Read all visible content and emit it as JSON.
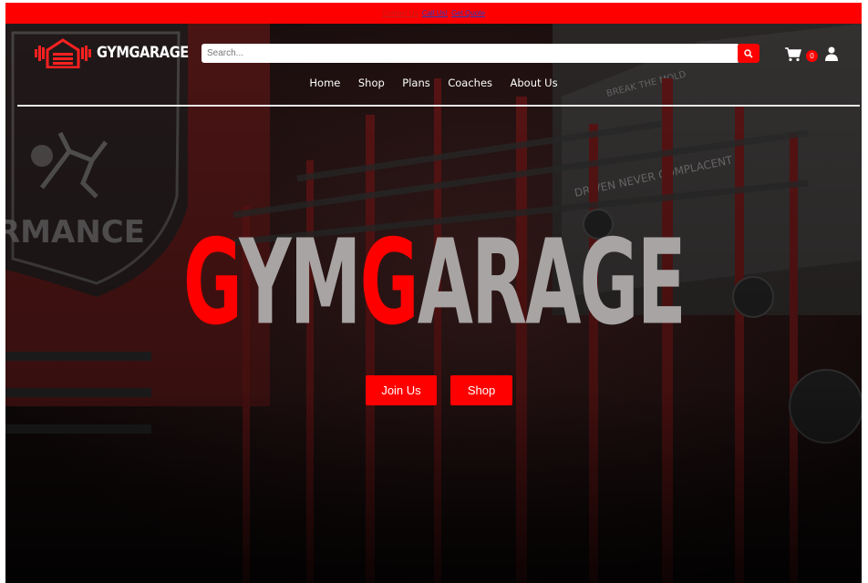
{
  "topbar": {
    "contact_label": "Contact Us",
    "call_label": "Call Us!",
    "quote_label": "Get Quote",
    "background_color": "#ff0000"
  },
  "brand": {
    "name": "GYMGARAGE",
    "logo_icon": "garage-dumbbell-icon",
    "accent_color": "#ff0000"
  },
  "search": {
    "placeholder": "Search...",
    "value": "",
    "button_icon": "search-icon"
  },
  "cart": {
    "icon": "cart-icon",
    "count": "0"
  },
  "account": {
    "icon": "user-icon"
  },
  "nav": {
    "items": [
      {
        "label": "Home"
      },
      {
        "label": "Shop"
      },
      {
        "label": "Plans"
      },
      {
        "label": "Coaches"
      },
      {
        "label": "About Us"
      }
    ]
  },
  "hero": {
    "title_parts": [
      {
        "text": "G",
        "color": "#ff0000"
      },
      {
        "text": "YM",
        "color": "#a8a4a4"
      },
      {
        "text": "G",
        "color": "#ff0000"
      },
      {
        "text": "ARAGE",
        "color": "#a8a4a4"
      }
    ],
    "join_label": "Join Us",
    "shop_label": "Shop"
  }
}
